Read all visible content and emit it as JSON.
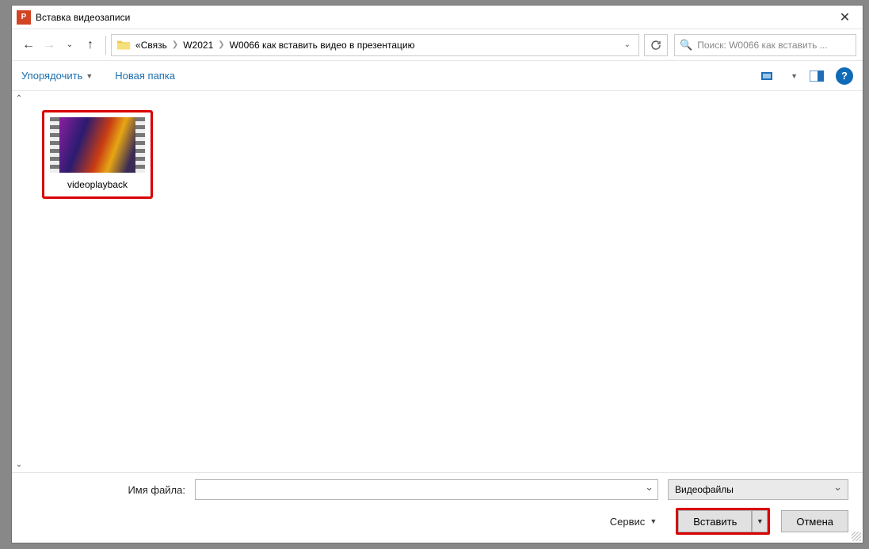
{
  "title": "Вставка видеозаписи",
  "breadcrumb": {
    "prefix": "«",
    "parts": [
      "Связь",
      "W2021",
      "W0066 как вставить видео в презентацию"
    ]
  },
  "search": {
    "placeholder": "Поиск: W0066 как вставить ..."
  },
  "toolbar": {
    "organize": "Упорядочить",
    "new_folder": "Новая папка"
  },
  "file": {
    "name": "videoplayback"
  },
  "footer": {
    "filename_label": "Имя файла:",
    "filename_value": "",
    "filetype": "Видеофайлы",
    "tools": "Сервис",
    "insert": "Вставить",
    "cancel": "Отмена"
  }
}
